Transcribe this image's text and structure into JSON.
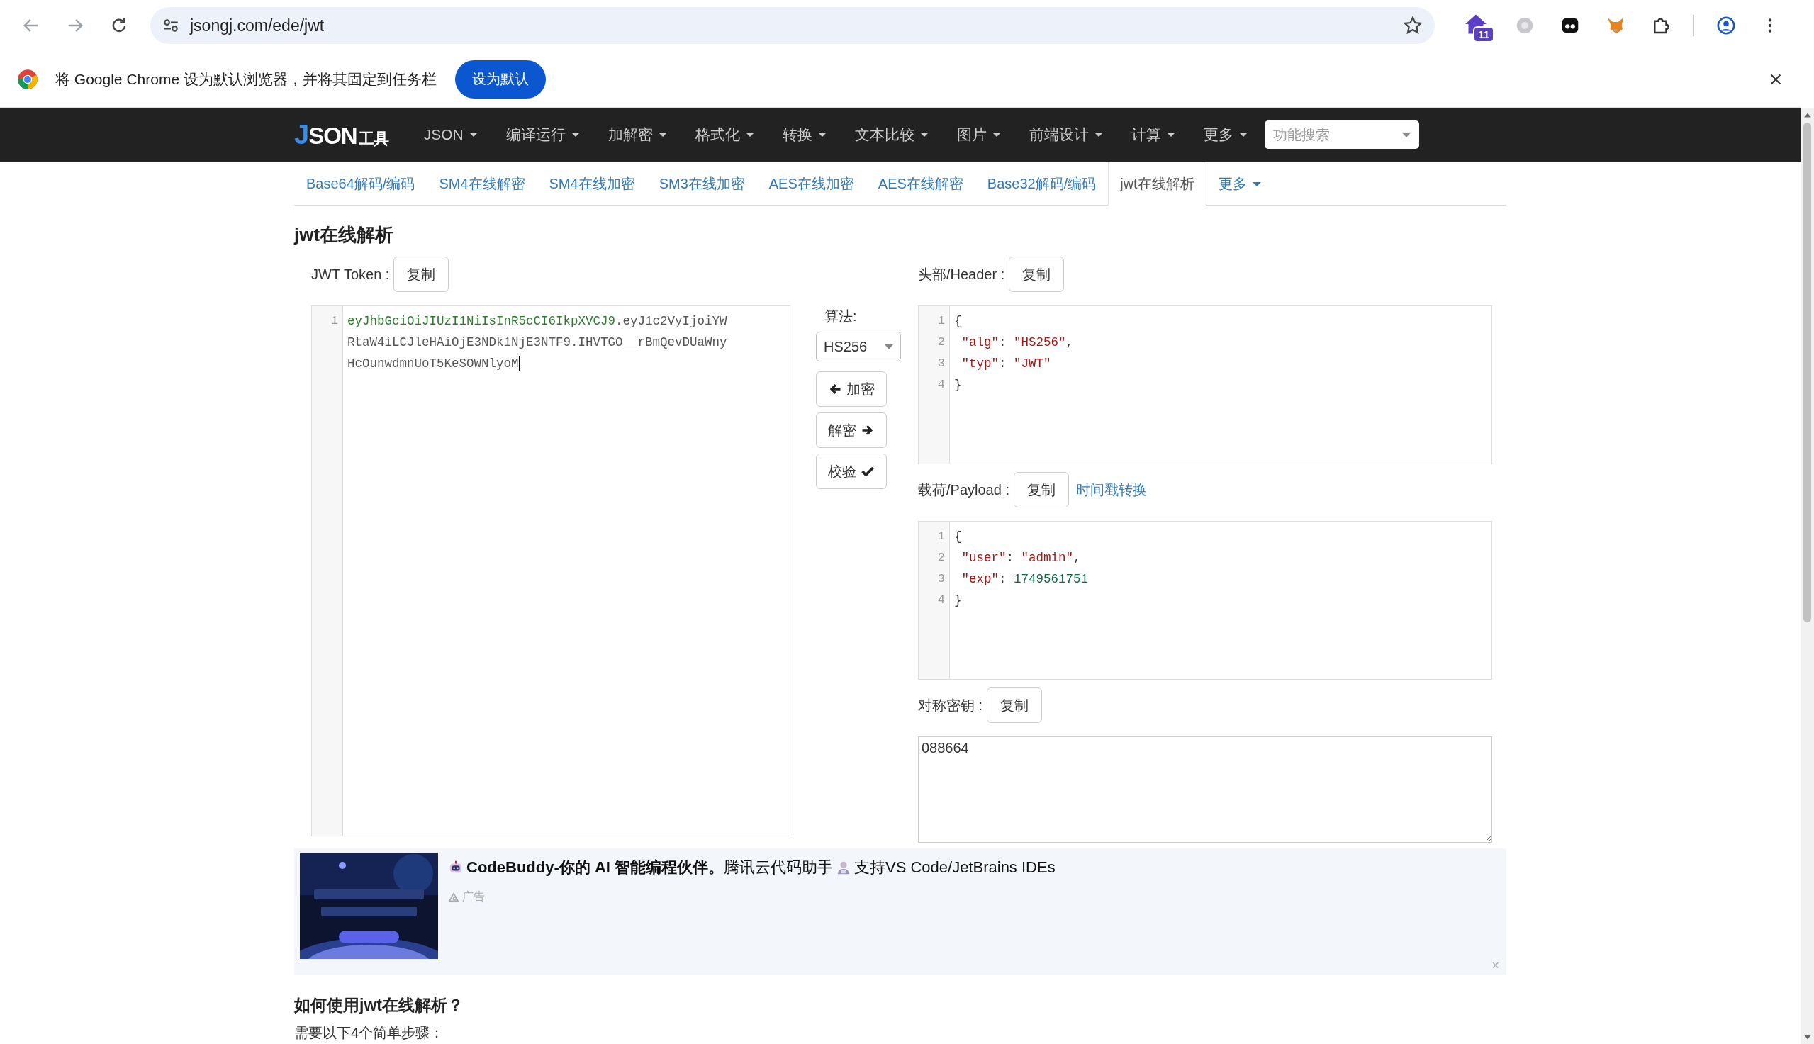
{
  "browser": {
    "url": "jsongj.com/ede/jwt",
    "extension_badge": "11",
    "infobar": {
      "message": "将 Google Chrome 设为默认浏览器，并将其固定到任务栏",
      "button": "设为默认"
    }
  },
  "nav": {
    "logo": {
      "accent": "J",
      "main": "SON",
      "suffix": "工具"
    },
    "menus": [
      "JSON",
      "编译运行",
      "加解密",
      "格式化",
      "转换",
      "文本比较",
      "图片",
      "前端设计",
      "计算",
      "更多"
    ],
    "search": {
      "placeholder": "功能搜索"
    }
  },
  "subnav": {
    "tabs": [
      {
        "label": "Base64解码/编码",
        "selected": false
      },
      {
        "label": "SM4在线解密",
        "selected": false
      },
      {
        "label": "SM4在线加密",
        "selected": false
      },
      {
        "label": "SM3在线加密",
        "selected": false
      },
      {
        "label": "AES在线加密",
        "selected": false
      },
      {
        "label": "AES在线解密",
        "selected": false
      },
      {
        "label": "Base32解码/编码",
        "selected": false
      },
      {
        "label": "jwt在线解析",
        "selected": true
      }
    ],
    "more": "更多"
  },
  "tool": {
    "title": "jwt在线解析",
    "token": {
      "label": "JWT Token :",
      "copy": "复制",
      "line_number": "1",
      "segments": [
        {
          "text": "eyJhbGciOiJIUzI1NiIsInR5cCI6IkpXVCJ9",
          "kind": "header"
        },
        {
          "text": ".eyJ1c2VyIjoiYWRtaW4iLCJleHAiOjE3NDk1NjE3NTF9.IHVTGO__rBmQevDUaWnyHcOunwdmnUoT5KeSOWNlyoM",
          "kind": "rest"
        }
      ]
    },
    "algorithm": {
      "label": "算法:",
      "value": "HS256"
    },
    "actions": [
      {
        "label": "加密",
        "kind": "encode"
      },
      {
        "label": "解密",
        "kind": "decode"
      },
      {
        "label": "校验",
        "kind": "verify"
      }
    ],
    "header": {
      "label": "头部/Header :",
      "copy": "复制",
      "lines": [
        {
          "no": "1",
          "tokens": [
            {
              "text": "{",
              "kind": "punct"
            }
          ]
        },
        {
          "no": "2",
          "tokens": [
            {
              "text": " \"alg\"",
              "kind": "string"
            },
            {
              "text": ": ",
              "kind": "punct"
            },
            {
              "text": "\"HS256\"",
              "kind": "string"
            },
            {
              "text": ",",
              "kind": "punct"
            }
          ]
        },
        {
          "no": "3",
          "tokens": [
            {
              "text": " \"typ\"",
              "kind": "string"
            },
            {
              "text": ": ",
              "kind": "punct"
            },
            {
              "text": "\"JWT\"",
              "kind": "string"
            }
          ]
        },
        {
          "no": "4",
          "tokens": [
            {
              "text": "}",
              "kind": "punct"
            }
          ]
        }
      ]
    },
    "payload": {
      "label": "载荷/Payload :",
      "copy": "复制",
      "link": "时间戳转换",
      "lines": [
        {
          "no": "1",
          "tokens": [
            {
              "text": "{",
              "kind": "punct"
            }
          ]
        },
        {
          "no": "2",
          "tokens": [
            {
              "text": " \"user\"",
              "kind": "string"
            },
            {
              "text": ": ",
              "kind": "punct"
            },
            {
              "text": "\"admin\"",
              "kind": "string"
            },
            {
              "text": ",",
              "kind": "punct"
            }
          ]
        },
        {
          "no": "3",
          "tokens": [
            {
              "text": " \"exp\"",
              "kind": "string"
            },
            {
              "text": ": ",
              "kind": "punct"
            },
            {
              "text": "1749561751",
              "kind": "number"
            }
          ]
        },
        {
          "no": "4",
          "tokens": [
            {
              "text": "}",
              "kind": "punct"
            }
          ]
        }
      ]
    },
    "key": {
      "label": "对称密钥 :",
      "copy": "复制",
      "value": "088664"
    }
  },
  "ad": {
    "title": "**CodeBuddy-你的 AI 智能编程伙伴。**腾讯云代码助手",
    "tagline": "支持VS Code/JetBrains IDEs",
    "label": "广告",
    "close": "×"
  },
  "guide": {
    "heading": "如何使用jwt在线解析？",
    "intro": "需要以下4个简单步骤："
  }
}
